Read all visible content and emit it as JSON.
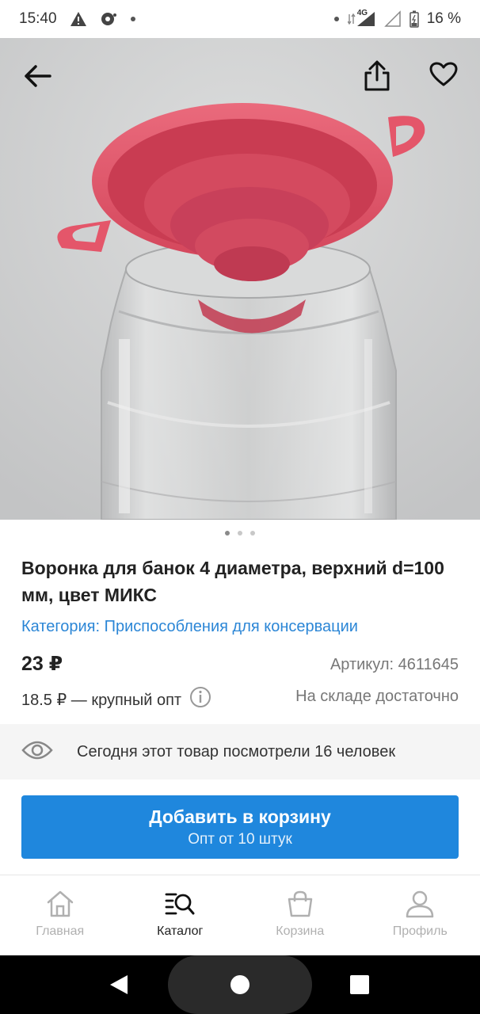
{
  "status_bar": {
    "time": "15:40",
    "network": "4G",
    "battery": "16 %"
  },
  "product": {
    "title": "Воронка для банок 4 диаметра, верхний d=100 мм, цвет МИКС",
    "category": "Категория: Приспособления для консервации",
    "price": "23 ₽",
    "sku": "Артикул: 4611645",
    "wholesale": "18.5 ₽ — крупный опт",
    "stock": "На складе достаточно",
    "image_count": 3,
    "image_index": 1
  },
  "views": {
    "text": "Сегодня этот товар посмотрели 16 человек"
  },
  "cart_button": {
    "label": "Добавить в корзину",
    "sublabel": "Опт от 10 штук"
  },
  "tabs": [
    {
      "label": "Главная",
      "icon": "home-icon"
    },
    {
      "label": "Каталог",
      "icon": "catalog-search-icon"
    },
    {
      "label": "Корзина",
      "icon": "cart-bag-icon"
    },
    {
      "label": "Профиль",
      "icon": "profile-icon"
    }
  ],
  "colors": {
    "accent": "#1f87dd",
    "link": "#2b86d6",
    "funnel": "#e4566a"
  }
}
